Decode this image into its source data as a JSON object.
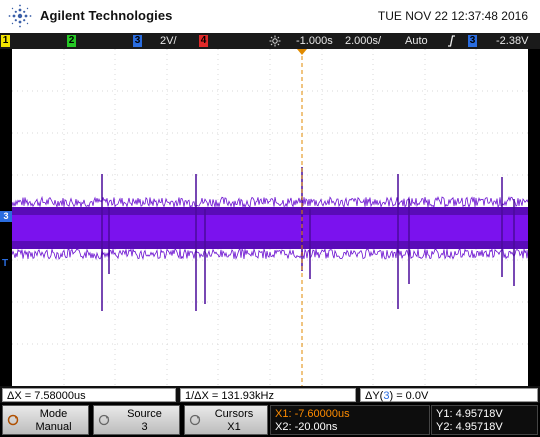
{
  "header": {
    "brand": "Agilent Technologies",
    "datetime": "TUE NOV 22 12:37:48 2016"
  },
  "status": {
    "ch1": "1",
    "ch2": "2",
    "ch3": "3",
    "ch4": "4",
    "ch2_scale": "2V/",
    "trigger_icon": "trigger-position-icon",
    "time_offset": "-1.000s",
    "timebase": "2.000s/",
    "trigger_mode": "Auto",
    "slope_icon": "rising-edge-icon",
    "trig_source": "3",
    "trig_level": "-2.38V",
    "colors": {
      "ch1": "#f2e400",
      "ch2": "#26c826",
      "ch3": "#2a6de0",
      "ch4": "#e02a2a",
      "trace": "#7a00ff",
      "cursor": "#ff8c00"
    }
  },
  "screen": {
    "ch3_marker": "3",
    "trigger_marker": "T",
    "trace_color": "#6a0fd0"
  },
  "measurements": {
    "dx": "ΔX = 7.58000us",
    "inv_dx": "1/ΔX = 131.93kHz",
    "dy_prefix": "ΔY(",
    "dy_channel": "3",
    "dy_suffix": ") = 0.0V"
  },
  "softkeys": {
    "mode_label": "Mode",
    "mode_value": "Manual",
    "source_label": "Source",
    "source_value": "3",
    "cursors_label": "Cursors",
    "cursors_value": "X1",
    "x1": "X1: -7.60000us",
    "x2": "X2: -20.00ns",
    "y1": "Y1: 4.95718V",
    "y2": "Y2: 4.95718V"
  }
}
